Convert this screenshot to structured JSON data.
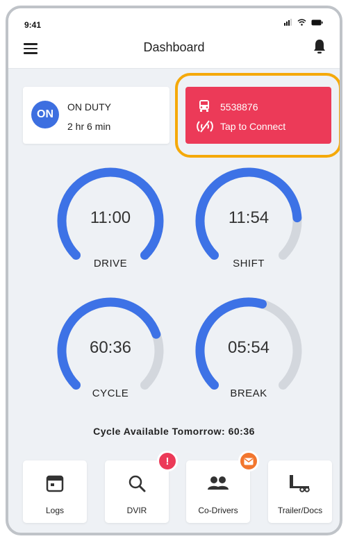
{
  "status_bar": {
    "time": "9:41"
  },
  "header": {
    "title": "Dashboard"
  },
  "duty": {
    "badge": "ON",
    "status": "ON DUTY",
    "elapsed": "2 hr 6 min"
  },
  "connect": {
    "truck_id": "5538876",
    "label": "Tap to Connect",
    "color": "#ec3a58",
    "highlight_color": "#f5a90a"
  },
  "gauges": [
    {
      "label": "DRIVE",
      "value": "11:00",
      "fraction": 1.0
    },
    {
      "label": "SHIFT",
      "value": "11:54",
      "fraction": 0.82
    },
    {
      "label": "CYCLE",
      "value": "60:36",
      "fraction": 0.76
    },
    {
      "label": "BREAK",
      "value": "05:54",
      "fraction": 0.56
    }
  ],
  "gauge_colors": {
    "filled": "#3d72e6",
    "track": "#d3d7dd"
  },
  "cycle_note": "Cycle Available Tomorrow: 60:36",
  "nav": [
    {
      "label": "Logs",
      "icon": "calendar-icon"
    },
    {
      "label": "DVIR",
      "icon": "search-icon",
      "badge": "!",
      "badge_color": "#ec3a58"
    },
    {
      "label": "Co-Drivers",
      "icon": "people-icon",
      "badge_icon": "mail-icon",
      "badge_color": "#f2762e"
    },
    {
      "label": "Trailer/Docs",
      "icon": "trailer-icon"
    }
  ]
}
